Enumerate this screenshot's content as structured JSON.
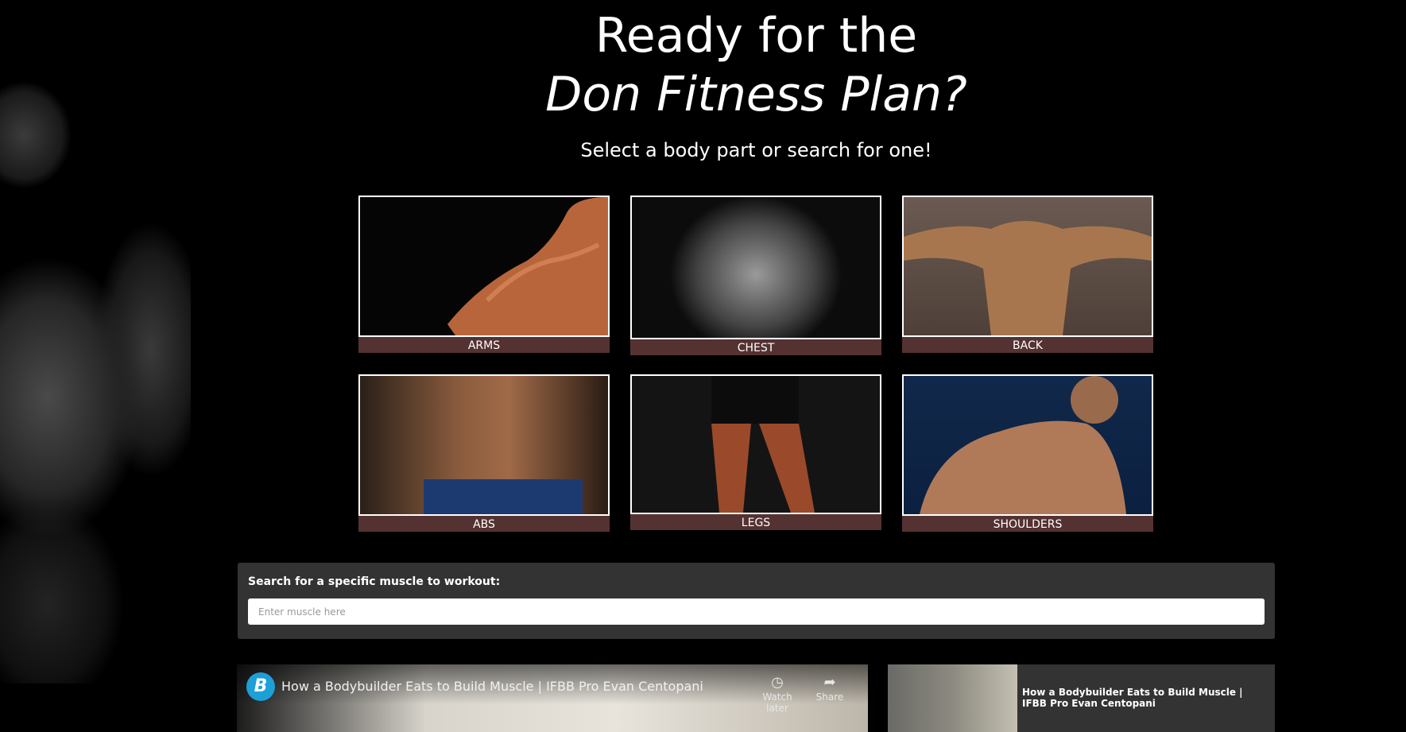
{
  "hero": {
    "line1": "Ready for the",
    "line2": "Don Fitness Plan?",
    "subtitle": "Select a body part or search for one!"
  },
  "body_parts": [
    {
      "label": "ARMS"
    },
    {
      "label": "CHEST"
    },
    {
      "label": "BACK"
    },
    {
      "label": "ABS"
    },
    {
      "label": "LEGS"
    },
    {
      "label": "SHOULDERS"
    }
  ],
  "search": {
    "label": "Search for a specific muscle to workout:",
    "placeholder": "Enter muscle here"
  },
  "video": {
    "title": "How a Bodybuilder Eats to Build Muscle | IFBB Pro Evan Centopani",
    "watch_later": "Watch later",
    "share": "Share",
    "logo_glyph": "B"
  },
  "side_video": {
    "title": "How a Bodybuilder Eats to Build Muscle | IFBB Pro Evan Centopani"
  },
  "colors": {
    "label_bar": "#553232",
    "search_panel": "#333333",
    "yt_logo": "#1d9fd8"
  }
}
